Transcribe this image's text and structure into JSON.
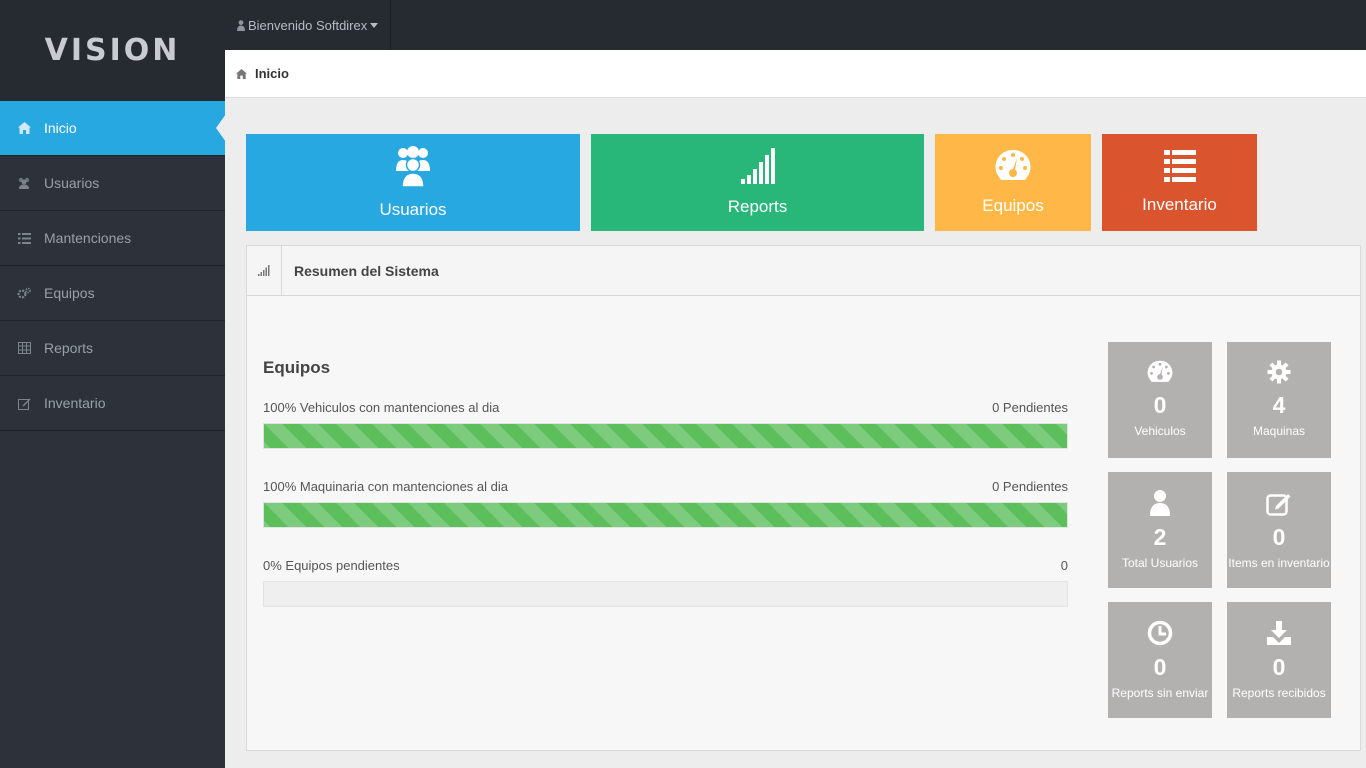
{
  "brand": {
    "logo": "VISION"
  },
  "user": {
    "greeting": "Bienvenido Softdirex"
  },
  "sidebar": {
    "items": [
      {
        "label": "Inicio",
        "icon": "home-icon"
      },
      {
        "label": "Usuarios",
        "icon": "users-icon"
      },
      {
        "label": "Mantenciones",
        "icon": "list-icon"
      },
      {
        "label": "Equipos",
        "icon": "gears-icon"
      },
      {
        "label": "Reports",
        "icon": "table-icon"
      },
      {
        "label": "Inventario",
        "icon": "edit-icon"
      }
    ]
  },
  "breadcrumb": {
    "label": "Inicio",
    "icon": "home-icon"
  },
  "tiles": [
    {
      "label": "Usuarios",
      "icon": "users-icon",
      "color": "#28a8e0"
    },
    {
      "label": "Reports",
      "icon": "signal-icon",
      "color": "#28b779"
    },
    {
      "label": "Equipos",
      "icon": "dashboard-icon",
      "color": "#ffb848"
    },
    {
      "label": "Inventario",
      "icon": "list-icon",
      "color": "#da542e"
    }
  ],
  "panel": {
    "title": "Resumen del Sistema",
    "icon": "signal-icon",
    "section_title": "Equipos",
    "progress": [
      {
        "label": "100% Vehiculos con mantenciones al dia",
        "right": "0 Pendientes",
        "value": 100
      },
      {
        "label": "100% Maquinaria con mantenciones al dia",
        "right": "0 Pendientes",
        "value": 100
      },
      {
        "label": "0% Equipos pendientes",
        "right": "0",
        "value": 0
      }
    ],
    "stats": [
      {
        "value": "0",
        "label": "Vehiculos",
        "icon": "dashboard-icon"
      },
      {
        "value": "4",
        "label": "Maquinas",
        "icon": "gear-icon"
      },
      {
        "value": "2",
        "label": "Total Usuarios",
        "icon": "user-icon"
      },
      {
        "value": "0",
        "label": "Items en inventario",
        "icon": "edit-icon"
      },
      {
        "value": "0",
        "label": "Reports sin enviar",
        "icon": "clock-icon"
      },
      {
        "value": "0",
        "label": "Reports recibidos",
        "icon": "download-icon"
      }
    ]
  },
  "colors": {
    "sidebar": "#2c313a",
    "accent": "#28a8e0",
    "progress": "#5cbf5c",
    "stat_tile": "#b3b0b0"
  }
}
